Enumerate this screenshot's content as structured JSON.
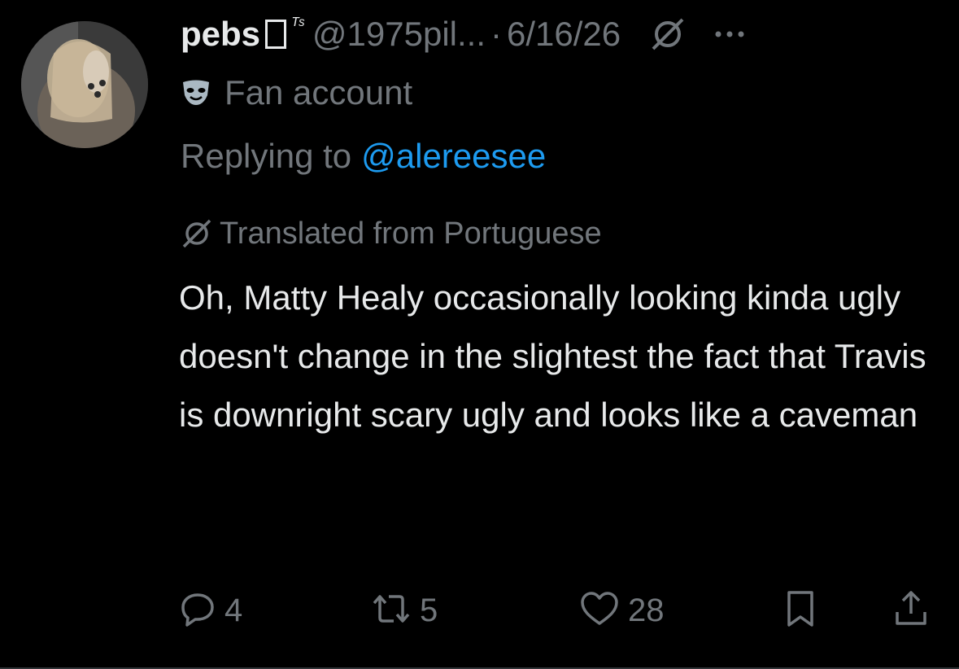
{
  "author": {
    "display_name": "pebs",
    "name_suffix": "ᵀˢ",
    "handle": "@1975pil...",
    "separator": "·",
    "date": "6/16/26",
    "label": "Fan account"
  },
  "reply": {
    "prefix": "Replying to",
    "handle": "@alereesee"
  },
  "translation_note": "Translated from Portuguese",
  "tweet_text": "Oh, Matty Healy occasionally looking kinda ugly doesn't change in the slightest the fact that Travis is downright scary ugly and looks like a caveman",
  "actions": {
    "replies": "4",
    "reposts": "5",
    "likes": "28"
  },
  "icons": {
    "header": [
      "grok-icon",
      "more-icon"
    ],
    "label": "mask-icon",
    "translation": "grok-icon",
    "actions": [
      "reply-icon",
      "repost-icon",
      "like-icon",
      "bookmark-icon",
      "share-icon"
    ]
  },
  "colors": {
    "background": "#000000",
    "primary_text": "#e7e9ea",
    "secondary_text": "#71767b",
    "link": "#1d9bf0"
  }
}
